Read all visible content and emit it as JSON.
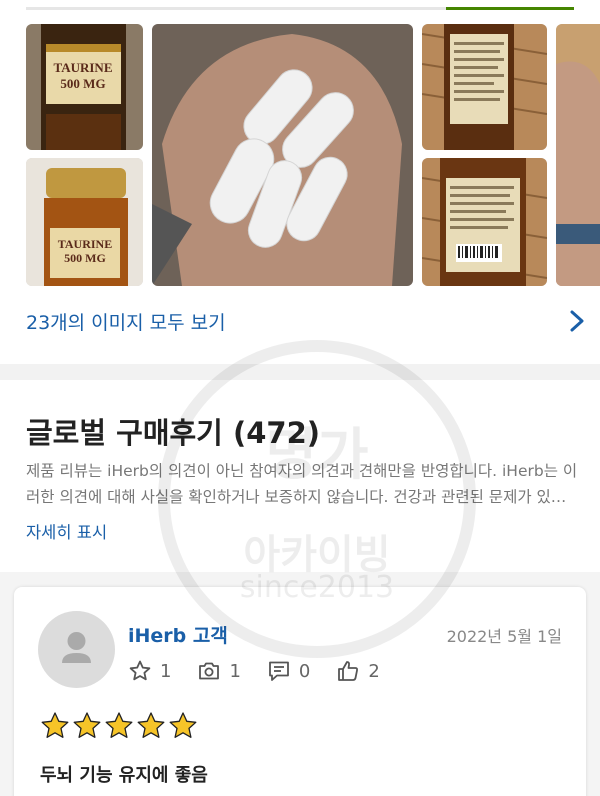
{
  "colors": {
    "link": "#1a5fa8",
    "tab_active": "#458500",
    "star": "#f6c428",
    "muted": "#777777"
  },
  "gallery": {
    "see_all_label": "23개의 이미지 모두 보기",
    "photos": [
      {
        "name": "taurine-bottle-front-1",
        "label": "TAURINE 500 MG"
      },
      {
        "name": "taurine-bottle-front-2",
        "label": "TAURINE 500 MG"
      },
      {
        "name": "capsules-in-hand"
      },
      {
        "name": "bottle-back-label-1"
      },
      {
        "name": "bottle-back-label-2"
      },
      {
        "name": "hand-photo-partial"
      }
    ]
  },
  "reviews": {
    "title": "글로벌 구매후기 (472)",
    "disclaimer": "제품 리뷰는 iHerb의 의견이 아닌 참여자의 의견과 견해만을 반영합니다. iHerb는 이러한 의견에 대해 사실을 확인하거나 보증하지 않습니다. 건강과 관련된 문제가 있는 경우 전문가와 상담하십시오.",
    "more_label": "자세히 표시"
  },
  "review": {
    "author": "iHerb 고객",
    "date": "2022년 5월 1일",
    "stats": {
      "stars_given": "1",
      "photos": "1",
      "comments": "0",
      "helpful": "2"
    },
    "rating": 5,
    "title": "두뇌 기능 유지에 좋음"
  },
  "watermark": {
    "line1": "명가",
    "line2": "아카이빙",
    "line3": "since2013"
  }
}
